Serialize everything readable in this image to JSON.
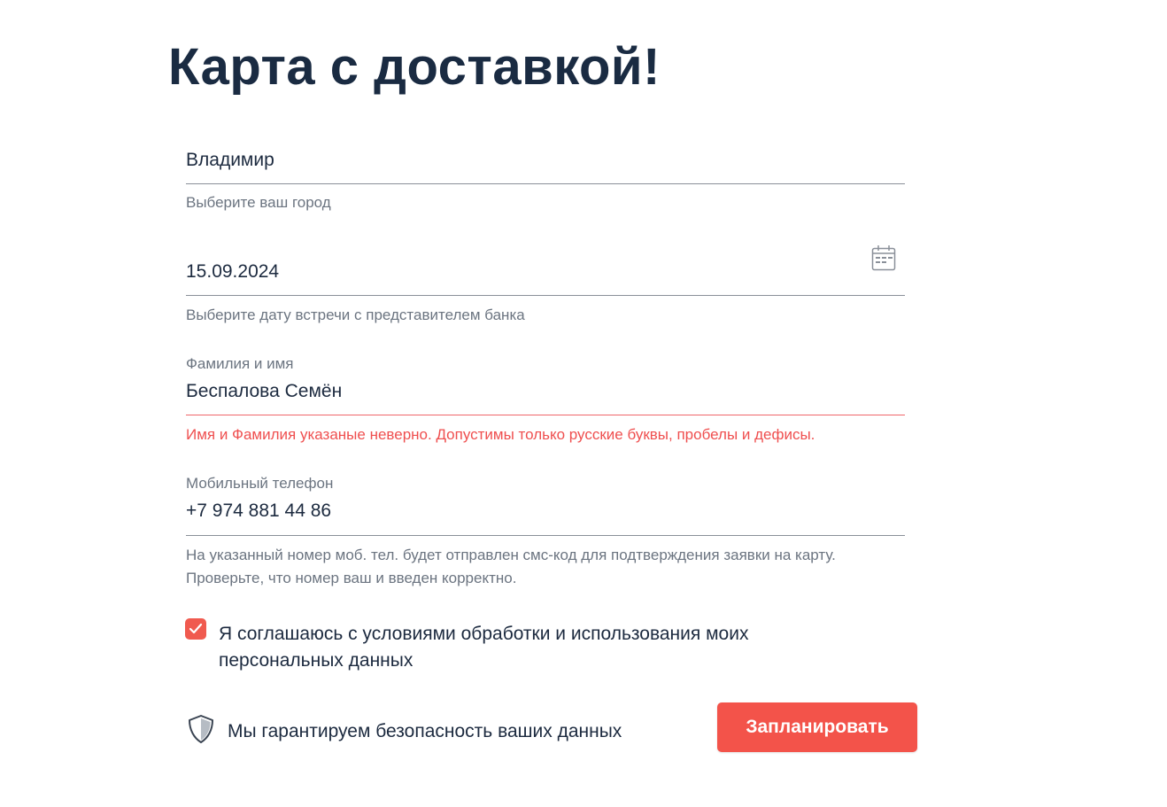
{
  "page": {
    "title": "Карта с доставкой!"
  },
  "form": {
    "city": {
      "value": "Владимир",
      "hint": "Выберите ваш город"
    },
    "date": {
      "value": "15.09.2024",
      "hint": "Выберите дату встречи с представителем банка",
      "icon": "calendar-icon"
    },
    "name": {
      "label": "Фамилия и имя",
      "value": "Беспалова Семён",
      "error": "Имя и Фамилия указаные неверно. Допустимы только русские буквы, пробелы и дефисы."
    },
    "phone": {
      "label": "Мобильный телефон",
      "value": "+7 974 881 44 86",
      "hint_line1": "На указанный номер моб. тел. будет отправлен смс-код для подтверждения заявки на карту.",
      "hint_line2": "Проверьте, что номер ваш и введен корректно."
    },
    "agreement": {
      "checked": true,
      "label": "Я соглашаюсь с условиями обработки и использования моих персональных данных"
    },
    "security": {
      "icon": "shield-icon",
      "text": "Мы гарантируем безопасность ваших данных"
    },
    "submit_label": "Запланировать"
  },
  "colors": {
    "accent": "#f3534a",
    "error": "#ef4f4f",
    "text": "#1c2a3f",
    "muted": "#6b7480"
  }
}
